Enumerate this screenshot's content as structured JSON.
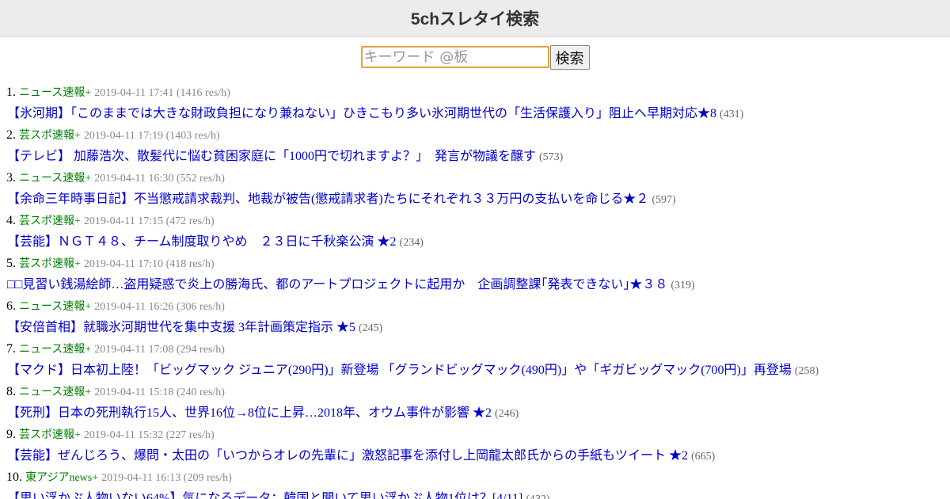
{
  "header": {
    "title": "5chスレタイ検索"
  },
  "search": {
    "placeholder": "キーワード @板",
    "button_label": "検索"
  },
  "results": [
    {
      "num": "1.",
      "board": "ニュース速報+",
      "meta": "2019-04-11 17:41 (1416 res/h)",
      "title": "【氷河期】「このままでは大きな財政負担になり兼ねない」ひきこもり多い氷河期世代の「生活保護入り」阻止へ早期対応★8",
      "count": "(431)"
    },
    {
      "num": "2.",
      "board": "芸スポ速報+",
      "meta": "2019-04-11 17:19 (1403 res/h)",
      "title": "【テレビ】 加藤浩次、散髪代に悩む貧困家庭に「1000円で切れますよ？」　発言が物議を醸す",
      "count": "(573)"
    },
    {
      "num": "3.",
      "board": "ニュース速報+",
      "meta": "2019-04-11 16:30 (552 res/h)",
      "title": "【余命三年時事日記】不当懲戒請求裁判、地裁が被告(懲戒請求者)たちにそれぞれ３３万円の支払いを命じる★２",
      "count": "(597)"
    },
    {
      "num": "4.",
      "board": "芸スポ速報+",
      "meta": "2019-04-11 17:15 (472 res/h)",
      "title": "【芸能】ＮＧＴ４８、チーム制度取りやめ　２３日に千秋楽公演 ★2",
      "count": "(234)"
    },
    {
      "num": "5.",
      "board": "芸スポ速報+",
      "meta": "2019-04-11 17:10 (418 res/h)",
      "title": "□□見習い銭湯絵師…盗用疑惑で炎上の勝海氏、都のアートプロジェクトに起用か　企画調整課｢発表できない｣★３８",
      "count": "(319)"
    },
    {
      "num": "6.",
      "board": "ニュース速報+",
      "meta": "2019-04-11 16:26 (306 res/h)",
      "title": "【安倍首相】就職氷河期世代を集中支援 3年計画策定指示 ★5",
      "count": "(245)"
    },
    {
      "num": "7.",
      "board": "ニュース速報+",
      "meta": "2019-04-11 17:08 (294 res/h)",
      "title": "【マクド】日本初上陸！「ビッグマック ジュニア(290円)」新登場 「グランドビッグマック(490円)」や「ギガビッグマック(700円)」再登場",
      "count": "(258)"
    },
    {
      "num": "8.",
      "board": "ニュース速報+",
      "meta": "2019-04-11 15:18 (240 res/h)",
      "title": "【死刑】日本の死刑執行15人、世界16位→8位に上昇…2018年、オウム事件が影響 ★2",
      "count": "(246)"
    },
    {
      "num": "9.",
      "board": "芸スポ速報+",
      "meta": "2019-04-11 15:32 (227 res/h)",
      "title": "【芸能】ぜんじろう、爆問・太田の「いつからオレの先輩に」激怒記事を添付し上岡龍太郎氏からの手紙もツイート ★2",
      "count": "(665)"
    },
    {
      "num": "10.",
      "board": "東アジアnews+",
      "meta": "2019-04-11 16:13 (209 res/h)",
      "title": "【思い浮かぶ人物いない64%】気になるデータ：韓国と聞いて思い浮かぶ人物1位は？[4/11]",
      "count": "(432)"
    }
  ]
}
